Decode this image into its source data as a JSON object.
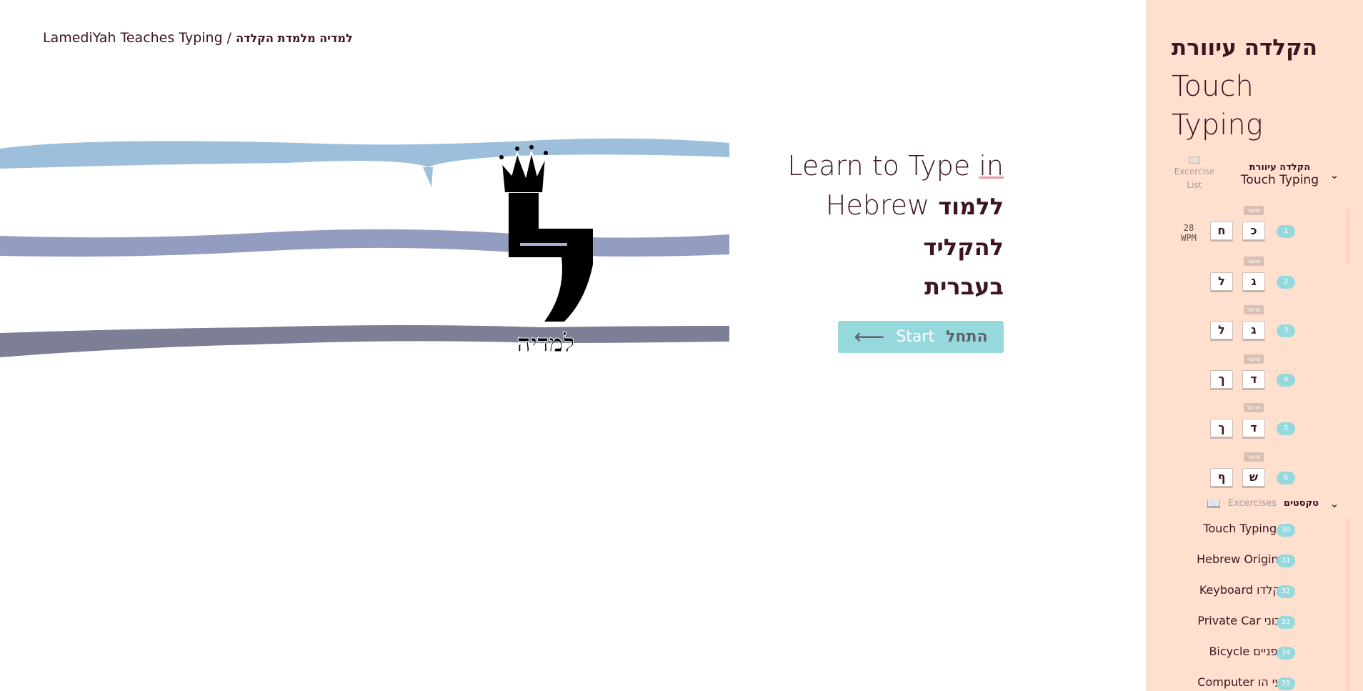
{
  "brand": {
    "english": "LamediYah Teaches Typing /",
    "hebrew": "למדיה מלמדת הקלדה"
  },
  "logo": {
    "letter": "ל",
    "wordmark_hebrew": "למדיה"
  },
  "hero": {
    "line1": "Learn to Type ",
    "line1_underlined": "in",
    "line2_english": "Hebrew ",
    "line2_hebrew": "ללמוד להקליד",
    "line3_hebrew": "בעברית"
  },
  "start_button": {
    "english": "Start",
    "hebrew": "התחל",
    "arrow": "⟵"
  },
  "sidebar": {
    "title_hebrew": "הקלדה עיוורת",
    "title_english_line1": "Touch",
    "title_english_line2": "Typing",
    "exercise_list_label_1": "Excercise",
    "exercise_list_label_2": "List",
    "section_hebrew": "הקלדה עיוורת",
    "section_english": "Touch Typing",
    "exercises": [
      {
        "number": "1",
        "kind": "שיעור",
        "keys": [
          "ח",
          "כ"
        ],
        "wpm_value": "28",
        "wpm_unit": "WPM"
      },
      {
        "number": "2",
        "kind": "שיעור",
        "keys": [
          "ל",
          "ג"
        ]
      },
      {
        "number": "3",
        "kind": "תרגול",
        "keys": [
          "ל",
          "ג"
        ]
      },
      {
        "number": "4",
        "kind": "שיעור",
        "keys": [
          "ך",
          "ד"
        ]
      },
      {
        "number": "5",
        "kind": "תרגול",
        "keys": [
          "ך",
          "ד"
        ]
      },
      {
        "number": "6",
        "kind": "שיעור",
        "keys": [
          "ף",
          "ש"
        ]
      }
    ],
    "texts_section": {
      "english": "Excercises",
      "hebrew": "טקסטים",
      "book_icon": "📖"
    },
    "texts": [
      {
        "number": "30",
        "title": "Touch Typing הק"
      },
      {
        "number": "31",
        "title": "Hebrew Origins מ"
      },
      {
        "number": "32",
        "title": "Keyboard המקלדו"
      },
      {
        "number": "33",
        "title": "Private Car המכוני"
      },
      {
        "number": "34",
        "title": "Bicycle האופניים"
      },
      {
        "number": "35",
        "title": "Computer מדעי הו"
      }
    ]
  },
  "colors": {
    "brand_text": "#3d1420",
    "accent_teal": "#96d9dc",
    "sidebar_bg": "#ffe0cf",
    "wave_light": "#9dbfdb",
    "wave_mid": "#939dbf",
    "wave_dark": "#7c7f96"
  }
}
